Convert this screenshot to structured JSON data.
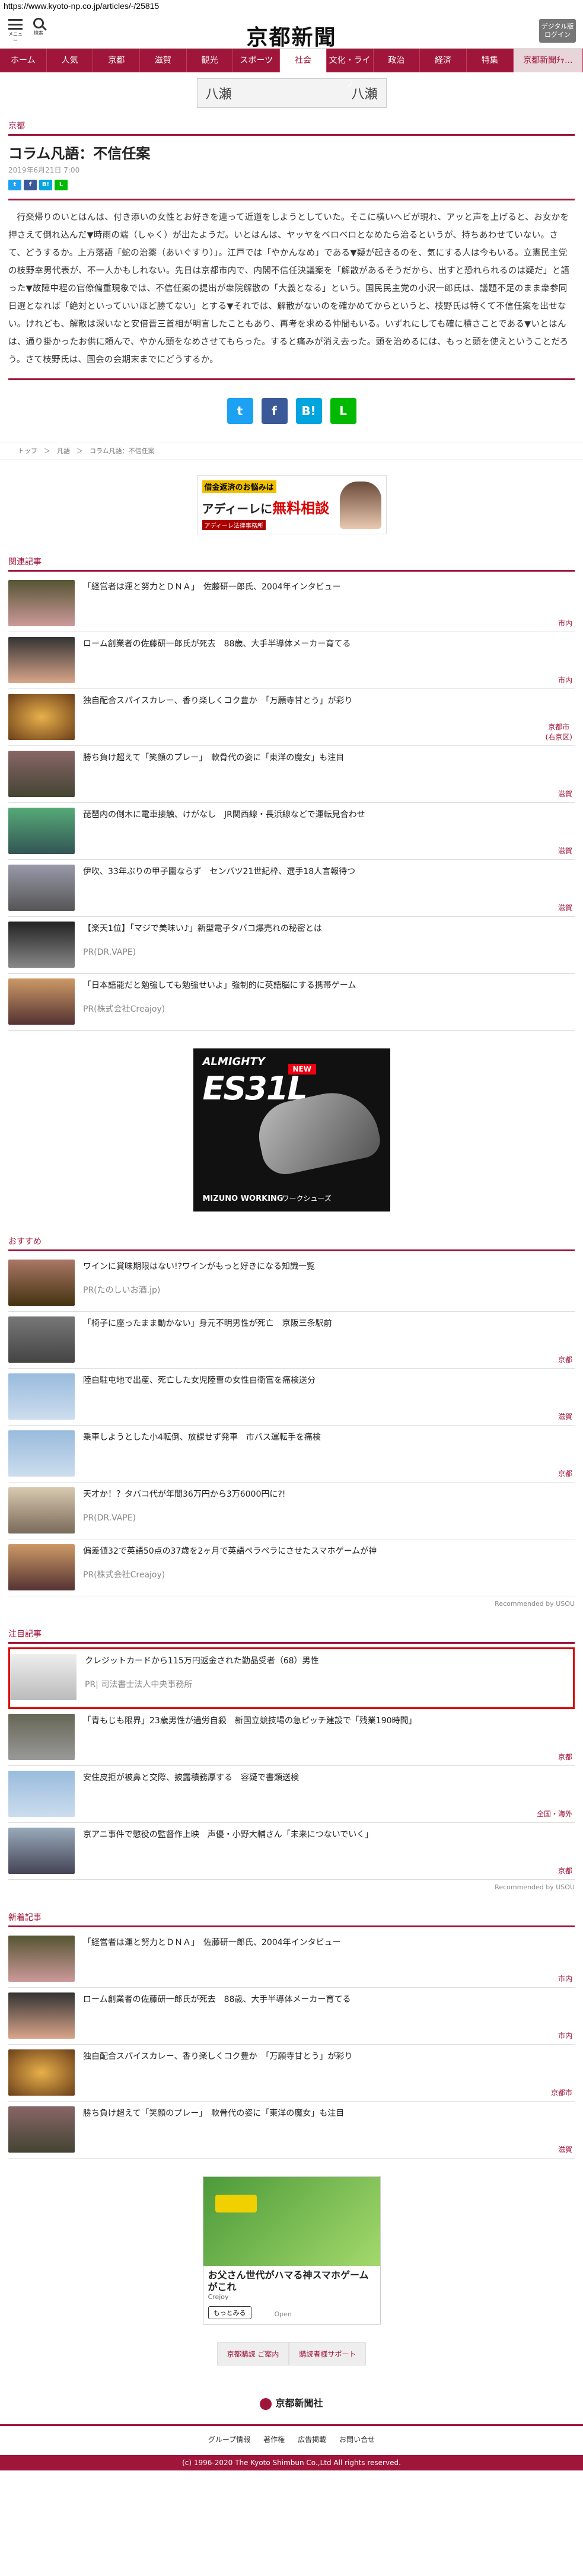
{
  "url": "https://www.kyoto-np.co.jp/articles/-/25815",
  "header": {
    "menu_label": "メニュー",
    "search_label": "検索",
    "logo": "京都新聞",
    "digital_btn": "デジタル版 ログイン"
  },
  "nav": [
    "ホーム",
    "人気",
    "京都",
    "滋賀",
    "観光",
    "スポーツ",
    "社会",
    "文化・ライフ",
    "政治",
    "経済",
    "特集",
    "京都新聞ﾁｬ..."
  ],
  "top_ad": {
    "left": "八瀬",
    "right": "八瀬"
  },
  "article": {
    "category": "京都",
    "title": "コラム凡語：不信任案",
    "date": "2019年6月21日 7:00",
    "body": "行楽帰りのいとはんは、付き添いの女性とお好きを連って近道をしようとしていた。そこに横いへビが現れ、アッと声を上げると、お女かを押さえて倒れ込んだ▼時雨の端（しゃく）が出たようだ。いとはんは、ヤッヤをベロベロとなめたら治るというが、持ちあわせていない。さて、どうするか。上方落語「蛇の治薬（あいぐすり）」。江戸では「やかんなめ」である▼疑が起きるのを、気にする人は今もいる。立憲民主党の枝野幸男代表が、不一人かもしれない。先日は京都市内で、内閣不信任決議案を「解散があるそうだから、出すと恐れられるのは疑だ」と語った▼故障中程の官僚偏重現象では、不信任案の提出が衆院解散の「大義となる」という。国民民主党の小沢一郎氏は、議題不足のまま衆参同日選となれば「絶対といっていいほど勝てない」とする▼それでは、解散がないのを確かめてからというと、枝野氏は特くて不信任案を出せない。けれども、解散は深いなと安倍晋三首相が明言したこともあり、再考を求める仲間もいる。いずれにしても確に積さことである▼いとはんは、通り掛かったお供に頼んで、やかん頭をなめさせてもらった。すると痛みが消え去った。頭を治めるには、もっと頭を使えということだろう。さて枝野氏は、国会の会期末までにどうするか。"
  },
  "breadcrumb": "トップ　＞　凡語　＞　コラム凡語：不信任案",
  "ad_mid": {
    "t1": "借金返済のお悩みは",
    "t2": "アディーレに",
    "t2b": "無料相談",
    "t3": "アディーレ法律事務所"
  },
  "related": {
    "title": "関連記事",
    "items": [
      {
        "text": "「経営者は運と努力とＤＮＡ」　佐藤研一郎氏、2004年インタビュー",
        "tag": "市内"
      },
      {
        "text": "ローム創業者の佐藤研一郎氏が死去　88歳、大手半導体メーカー育てる",
        "tag": "市内"
      },
      {
        "text": "独自配合スパイスカレー、香り楽しくコク豊か　「万願寺甘とう」が彩り",
        "tag": "京都市\n(右京区)"
      },
      {
        "text": "勝ち負け超えて「笑顔のプレー」　軟骨代の姿に「東洋の魔女」も注目",
        "tag": "滋賀"
      },
      {
        "text": "琵琶内の倒木に電車接触、けがなし　JR関西線・長浜線などで運転見合わせ",
        "tag": "滋賀"
      },
      {
        "text": "伊吹、33年ぶりの甲子園ならず　センバツ21世紀枠、選手18人言報待つ",
        "tag": "滋賀"
      },
      {
        "text": "【楽天1位】「マジで美味い♪」新型電子タバコ爆売れの秘密とは",
        "pr": "PR(DR.VAPE)"
      },
      {
        "text": "「日本語能だと勉強しても勉強せいよ」強制的に英語脳にする携帯ゲーム",
        "pr": "PR(株式会社Creajoy)"
      }
    ]
  },
  "ad_shoe": {
    "brand": "ALMIGHTY",
    "model": "ES31L",
    "new": "NEW",
    "maker": "MIZUNO WORKING",
    "type": "ワークシューズ"
  },
  "recommend": {
    "title": "おすすめ",
    "items": [
      {
        "text": "ワインに賞味期限はない!?ワインがもっと好きになる知識一覧",
        "pr": "PR(たのしいお酒.jp)"
      },
      {
        "text": "「椅子に座ったまま動かない」身元不明男性が死亡　京阪三条駅前",
        "tag": "京都"
      },
      {
        "text": "陸自駐屯地で出産、死亡した女児陸曹の女性自衛官を痛検送分",
        "tag": "滋賀"
      },
      {
        "text": "乗車しようとした小4転倒、放課せず発車　市バス運転手を痛検",
        "tag": "京都"
      },
      {
        "text": "天才か！？タバコ代が年間36万円から3万6000円に?!",
        "pr": "PR(DR.VAPE)"
      },
      {
        "text": "偏差値32で英語50点の37歳を2ヶ月で英語ペラペラにさせたスマホゲームが神",
        "pr": "PR(株式会社Creajoy)"
      }
    ],
    "by": "Recommended by USOU"
  },
  "attention": {
    "title": "注目記事",
    "items": [
      {
        "text": "クレジットカードから115万円返金された勤品受者（68）男性",
        "pr": "PR| 司法書士法人中央事務所"
      },
      {
        "text": "「青もじも限界」23歳男性が過労自殺　新国立競技場の急ピッチ建設で「残業190時間」",
        "tag": "京都"
      },
      {
        "text": "安住皮拒が被鼻と交際、披露積務厚する　容疑で書類送検",
        "tag": "全国・海外"
      },
      {
        "text": "京アニ事件で懲役の監督作上映　声優・小野大輔さん「未来につないでいく」",
        "tag": "京都"
      }
    ],
    "by": "Recommended by USOU"
  },
  "newest": {
    "title": "新着記事",
    "items": [
      {
        "text": "「経営者は運と努力とＤＮＡ」　佐藤研一郎氏、2004年インタビュー",
        "tag": "市内"
      },
      {
        "text": "ローム創業者の佐藤研一郎氏が死去　88歳、大手半導体メーカー育てる",
        "tag": "市内"
      },
      {
        "text": "独自配合スパイスカレー、香り楽しくコク豊か　「万願寺甘とう」が彩り",
        "tag": "京都市"
      },
      {
        "text": "勝ち負け超えて「笑顔のプレー」　軟骨代の姿に「東洋の魔女」も注目",
        "tag": "滋賀"
      }
    ]
  },
  "ad_game": {
    "title": "お父さん世代がハマる神スマホゲームがこれ",
    "sub": "Crejoy",
    "more": "もっとみる",
    "open": "Open"
  },
  "footer_buttons": [
    "京都購読 ご案内",
    "購読者様サポート"
  ],
  "footer_logo": "京都新聞社",
  "footer_links": [
    "グループ情報",
    "著作権",
    "広告掲載",
    "お問い合せ"
  ],
  "copyright": "(c) 1996-2020 The Kyoto Shimbun Co.,Ltd All rights reserved."
}
